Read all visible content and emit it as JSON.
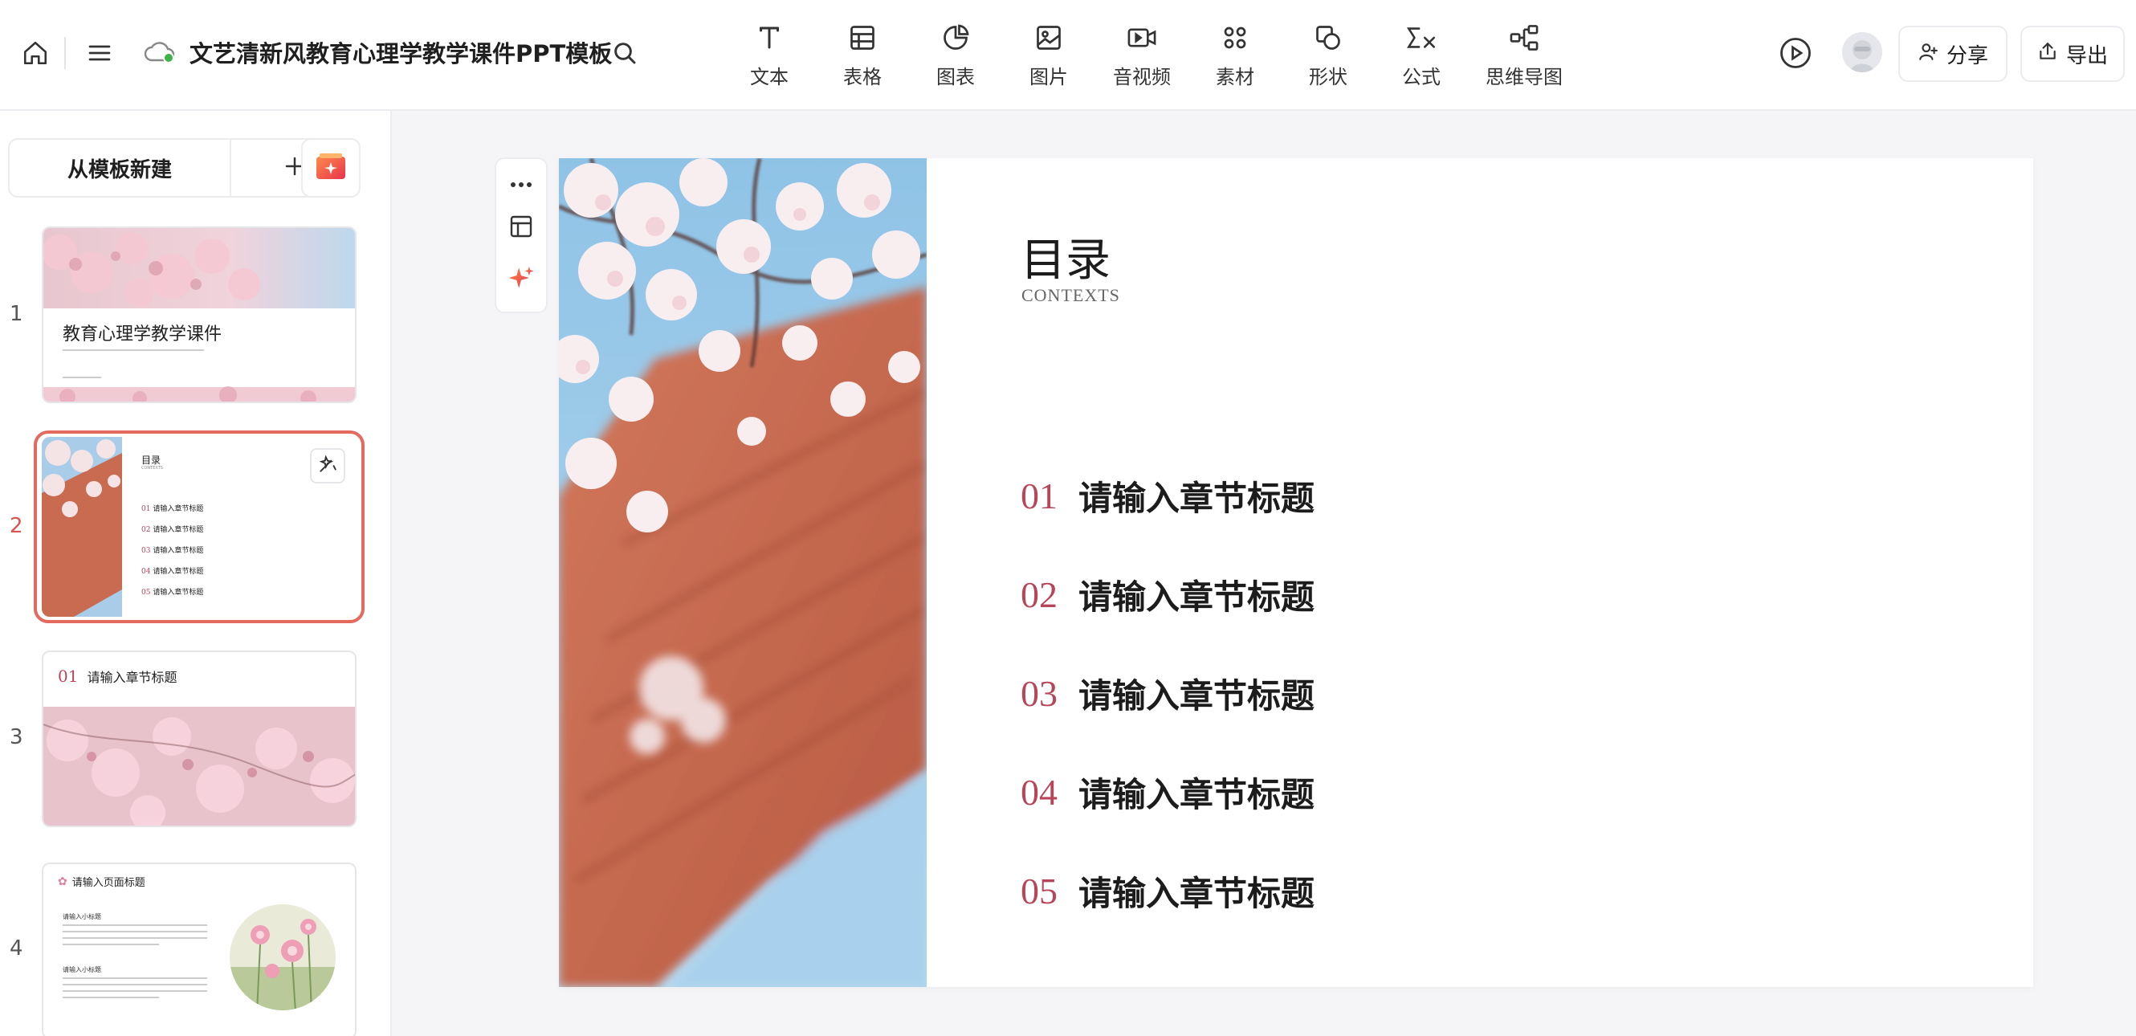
{
  "header": {
    "title": "文艺清新风教育心理学教学课件PPT模板",
    "tools": [
      {
        "label": "文本",
        "icon": "text-icon"
      },
      {
        "label": "表格",
        "icon": "table-icon"
      },
      {
        "label": "图表",
        "icon": "chart-icon"
      },
      {
        "label": "图片",
        "icon": "image-icon"
      },
      {
        "label": "音视频",
        "icon": "video-icon"
      },
      {
        "label": "素材",
        "icon": "assets-icon"
      },
      {
        "label": "形状",
        "icon": "shape-icon"
      },
      {
        "label": "公式",
        "icon": "formula-icon"
      },
      {
        "label": "思维导图",
        "icon": "mindmap-icon"
      }
    ],
    "share_label": "分享",
    "export_label": "导出"
  },
  "sidebar": {
    "new_from_template": "从模板新建",
    "slides": [
      {
        "number": "1",
        "title": "教育心理学教学课件"
      },
      {
        "number": "2",
        "title": "目录",
        "subtitle": "CONTEXTS",
        "items": [
          "01",
          "02",
          "03",
          "04",
          "05"
        ],
        "item_text": "请输入章节标题"
      },
      {
        "number": "3",
        "title": "请输入章节标题",
        "num": "01"
      },
      {
        "number": "4",
        "title": "请输入页面标题",
        "sub1": "请输入小标题",
        "sub2": "请输入小标题"
      }
    ]
  },
  "slide": {
    "title": "目录",
    "subtitle": "CONTEXTS",
    "items": [
      {
        "num": "01",
        "text": "请输入章节标题"
      },
      {
        "num": "02",
        "text": "请输入章节标题"
      },
      {
        "num": "03",
        "text": "请输入章节标题"
      },
      {
        "num": "04",
        "text": "请输入章节标题"
      },
      {
        "num": "05",
        "text": "请输入章节标题"
      }
    ]
  },
  "colors": {
    "accent": "#b8465a",
    "active_ring": "#e4695f",
    "cloud_ok": "#3bb54a"
  }
}
